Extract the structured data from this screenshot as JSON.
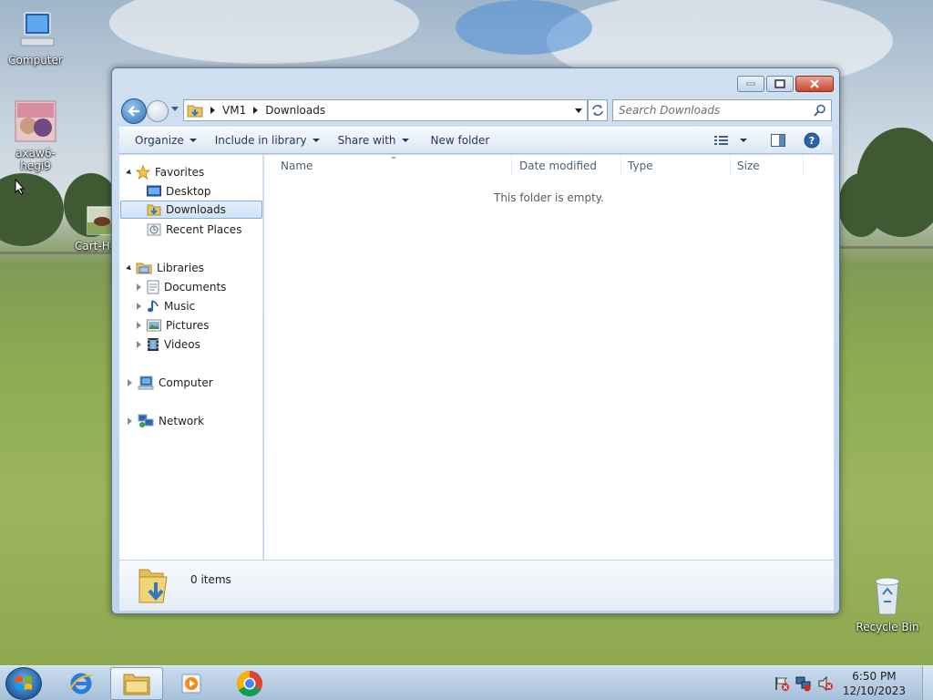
{
  "desktop": {
    "icons": [
      {
        "label": "Computer"
      },
      {
        "label": "axaw6-hegi9"
      },
      {
        "label": "Cart-Ho"
      },
      {
        "label": "Recycle Bin"
      }
    ]
  },
  "window": {
    "address": {
      "crumbs": [
        "VM1",
        "Downloads"
      ]
    },
    "search": {
      "placeholder": "Search Downloads"
    },
    "toolbar": {
      "organize": "Organize",
      "include_in_library": "Include in library",
      "share_with": "Share with",
      "new_folder": "New folder"
    },
    "nav": {
      "favorites": "Favorites",
      "desktop": "Desktop",
      "downloads": "Downloads",
      "recent_places": "Recent Places",
      "libraries": "Libraries",
      "documents": "Documents",
      "music": "Music",
      "pictures": "Pictures",
      "videos": "Videos",
      "computer": "Computer",
      "network": "Network"
    },
    "columns": {
      "name": "Name",
      "date_modified": "Date modified",
      "type": "Type",
      "size": "Size"
    },
    "empty_message": "This folder is empty.",
    "details": {
      "item_count": "0 items"
    }
  },
  "taskbar": {
    "clock": {
      "time": "6:50 PM",
      "date": "12/10/2023"
    }
  },
  "colors": {
    "selection_border": "#84acdd",
    "window_frame": "#bcd3ea",
    "close_button": "#c8462f"
  }
}
